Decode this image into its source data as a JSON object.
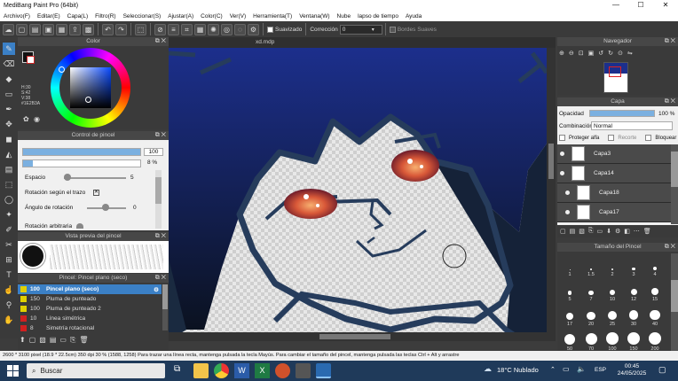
{
  "window": {
    "title": "MediBang Paint Pro (64bit)",
    "min": "—",
    "max": "☐",
    "close": "✕"
  },
  "menu": [
    "Archivo(F)",
    "Editar(E)",
    "Capa(L)",
    "Filtro(R)",
    "Seleccionar(S)",
    "Ajustar(A)",
    "Color(C)",
    "Ver(V)",
    "Herramienta(T)",
    "Ventana(W)",
    "Nube",
    "lapso de tiempo",
    "Ayuda"
  ],
  "toolbar": {
    "smooth_label": "Suavizado",
    "correction_label": "Corrección",
    "correction_value": "0",
    "border_label": "Bordes Suaves"
  },
  "document": {
    "tab": "xd.mdp"
  },
  "color_panel": {
    "title": "Color",
    "h": "H:30",
    "s": "S:42",
    "v": "V:38",
    "hex": "#1E2B3A",
    "main_color": "#1e2b3a"
  },
  "brush_control": {
    "title": "Control de pincel",
    "size_value": "100",
    "opacity_value": "8 %",
    "spacing_label": "Espacio",
    "spacing_value": "5",
    "rotation_label": "Rotación según el trazo",
    "angle_label": "Ángulo de rotación",
    "angle_value": "0",
    "random_label": "Rotación arbitraria",
    "random_value": "0"
  },
  "brush_preview": {
    "title": "Vista previa del pincel"
  },
  "brush_list": {
    "title": "Pincel: Pincel plano (seco)",
    "items": [
      {
        "size": "100",
        "name": "Pincel plano (seco)",
        "color": "#e0d000",
        "selected": true
      },
      {
        "size": "150",
        "name": "Pluma de punteado",
        "color": "#e0d000",
        "selected": false
      },
      {
        "size": "100",
        "name": "Pluma de punteado 2",
        "color": "#e0d000",
        "selected": false
      },
      {
        "size": "10",
        "name": "Línea simétrica",
        "color": "#d02020",
        "selected": false
      },
      {
        "size": "8",
        "name": "Simetría rotacional",
        "color": "#d02020",
        "selected": false
      }
    ]
  },
  "navigator": {
    "title": "Navegador"
  },
  "layers": {
    "title": "Capa",
    "opacity_label": "Opacidad",
    "opacity_value": "100 %",
    "blend_label": "Combinación",
    "blend_value": "Normal",
    "protect_alpha": "Proteger alfa",
    "clipping": "Recorte",
    "lock": "Bloquear",
    "items": [
      {
        "name": "Capa3",
        "indent": false
      },
      {
        "name": "Capa14",
        "indent": false
      },
      {
        "name": "Capa18",
        "indent": true
      },
      {
        "name": "Capa17",
        "indent": true
      }
    ]
  },
  "brush_size": {
    "title": "Tamaño del Pincel",
    "values": [
      "1",
      "1.5",
      "2",
      "3",
      "4",
      "5",
      "7",
      "10",
      "12",
      "15",
      "17",
      "20",
      "25",
      "30",
      "40",
      "50",
      "70",
      "100",
      "150",
      "200"
    ]
  },
  "status": {
    "text": "2600 * 3100 pixel (18.9 * 22.5cm) 350 dpi 30 % (1588, 1258) Para trazar una línea recta, mantenga pulsada la tecla Mayús. Para cambiar el tamaño del pincel, mantenga pulsada las teclas Ctrl + Alt y arrastre"
  },
  "taskbar": {
    "search": "Buscar",
    "weather": "18°C Nublado",
    "lang": "ESP",
    "time": "00:45",
    "date": "24/05/2025"
  },
  "colors": {
    "accent": "#3b80c6",
    "hair": "#1c2f8c",
    "outline": "#263c5c",
    "eye": "#d85838"
  }
}
